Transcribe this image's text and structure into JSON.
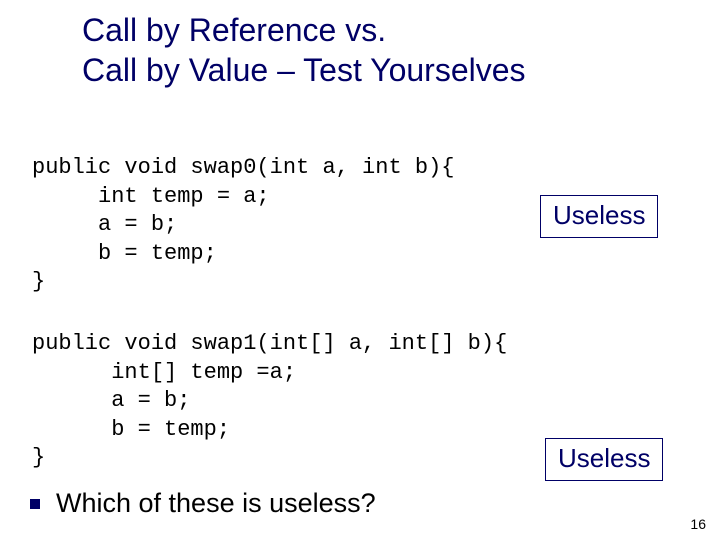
{
  "title_line1": "Call by Reference vs.",
  "title_line2": "Call by Value – Test Yourselves",
  "code_block_1": "public void swap0(int a, int b){\n     int temp = a;\n     a = b;\n     b = temp;\n}",
  "code_block_2": "public void swap1(int[] a, int[] b){\n      int[] temp =a;\n      a = b;\n      b = temp;\n}",
  "annotation_1": "Useless",
  "annotation_2": "Useless",
  "question": "Which of these is useless?",
  "page_number": "16"
}
